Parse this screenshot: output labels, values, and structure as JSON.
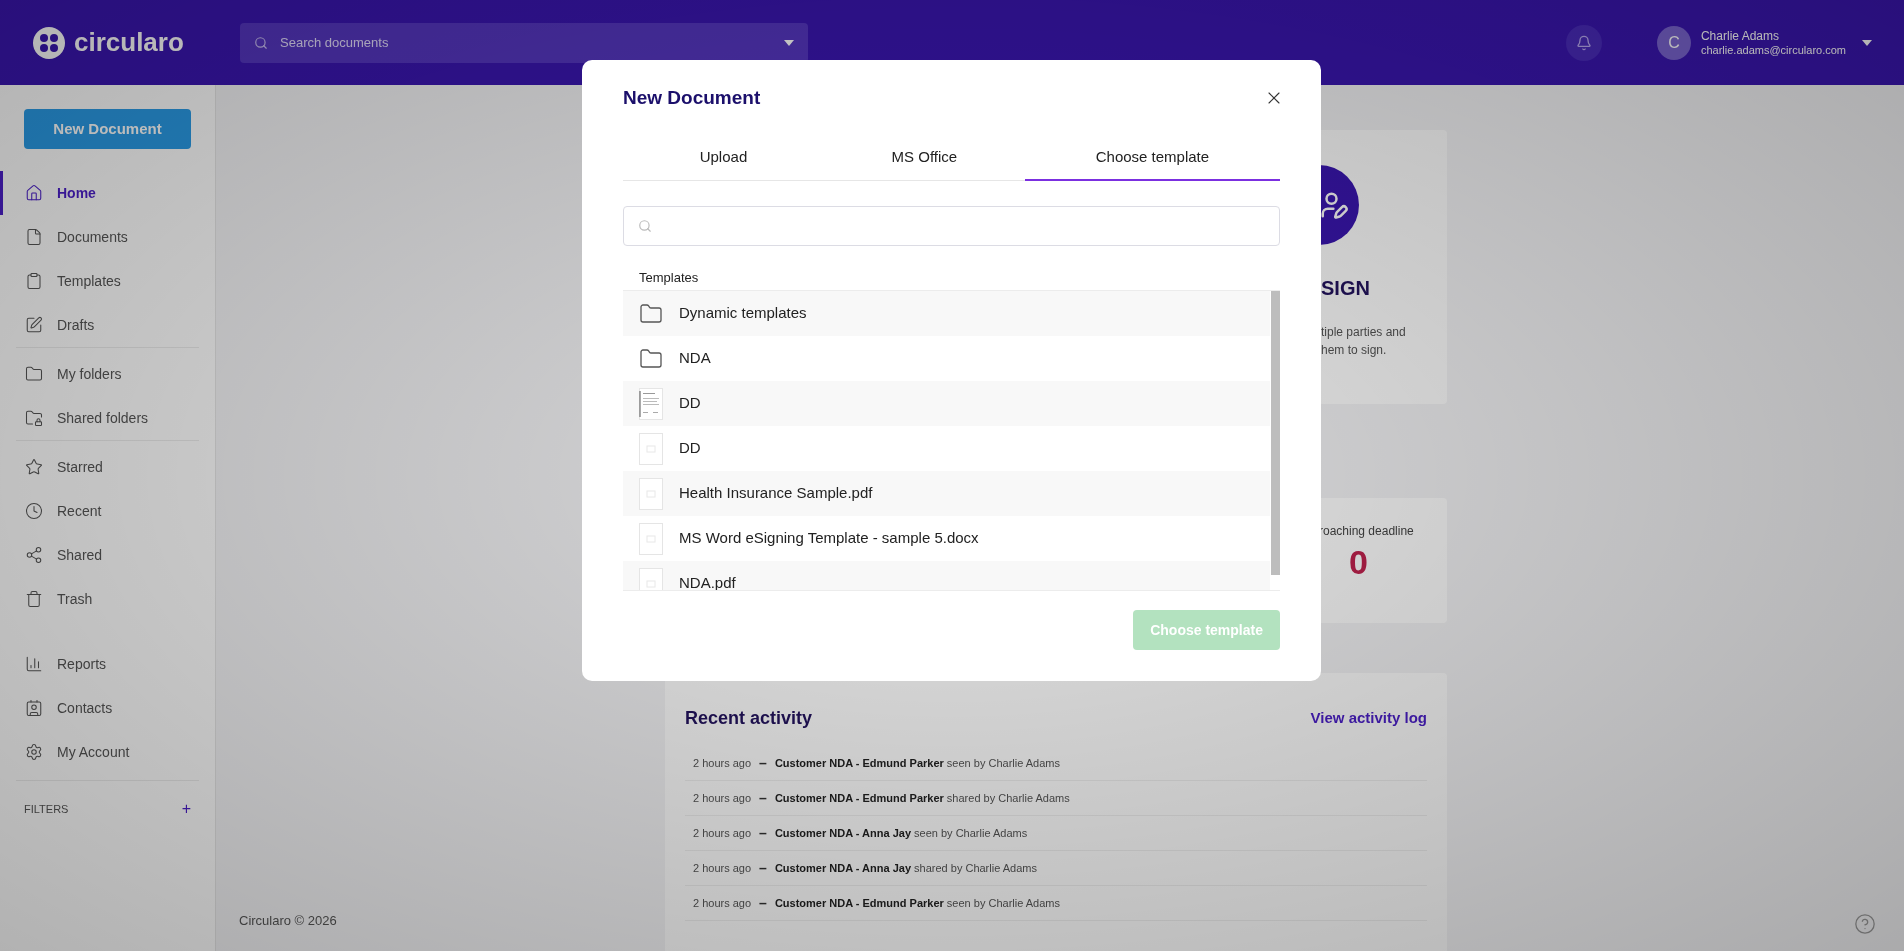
{
  "header": {
    "logo": "circularo",
    "search_placeholder": "Search documents",
    "user": {
      "initial": "C",
      "name": "Charlie Adams",
      "email": "charlie.adams@circularo.com"
    }
  },
  "sidebar": {
    "new_button": "New Document",
    "groups": [
      [
        {
          "label": "Home",
          "selected": true
        },
        {
          "label": "Documents",
          "selected": false
        },
        {
          "label": "Templates",
          "selected": false
        },
        {
          "label": "Drafts",
          "selected": false
        }
      ],
      [
        {
          "label": "My folders",
          "selected": false
        },
        {
          "label": "Shared folders",
          "selected": false
        }
      ],
      [
        {
          "label": "Starred",
          "selected": false
        },
        {
          "label": "Recent",
          "selected": false
        },
        {
          "label": "Shared",
          "selected": false
        },
        {
          "label": "Trash",
          "selected": false
        }
      ],
      [
        {
          "label": "Reports",
          "selected": false
        },
        {
          "label": "Contacts",
          "selected": false
        },
        {
          "label": "My Account",
          "selected": false
        }
      ]
    ],
    "filters_label": "FILTERS",
    "filters_add": "+"
  },
  "sign_card": {
    "title": "SIGN",
    "text": "tiple parties and\nhem to sign."
  },
  "deadline_card": {
    "label": "roaching deadline",
    "value": "0"
  },
  "activity": {
    "title": "Recent activity",
    "link": "View activity log",
    "rows": [
      {
        "time": "2 hours ago",
        "separator": "–",
        "text": "**Customer NDA - Edmund Parker** seen by Charlie Adams"
      },
      {
        "time": "2 hours ago",
        "separator": "–",
        "text": "**Customer NDA - Edmund Parker** shared by Charlie Adams"
      },
      {
        "time": "2 hours ago",
        "separator": "–",
        "text": "**Customer NDA - Anna Jay** seen by Charlie Adams"
      },
      {
        "time": "2 hours ago",
        "separator": "–",
        "text": "**Customer NDA - Anna Jay** shared by Charlie Adams"
      },
      {
        "time": "2 hours ago",
        "separator": "–",
        "text": "**Customer NDA - Edmund Parker** seen by Charlie Adams"
      }
    ]
  },
  "footer": "Circularo © 2026",
  "modal": {
    "title": "New Document",
    "tabs": [
      {
        "label": "Upload",
        "selected": false
      },
      {
        "label": "MS Office",
        "selected": false
      },
      {
        "label": "Choose template",
        "selected": true
      }
    ],
    "list_header": "Templates",
    "items": [
      {
        "kind": "folder",
        "name": "Dynamic templates"
      },
      {
        "kind": "folder",
        "name": "NDA"
      },
      {
        "kind": "preview",
        "name": "DD"
      },
      {
        "kind": "file",
        "name": "DD"
      },
      {
        "kind": "file",
        "name": "Health Insurance Sample.pdf"
      },
      {
        "kind": "file",
        "name": "MS Word eSigning Template - sample 5.docx"
      },
      {
        "kind": "file",
        "name": "NDA.pdf"
      }
    ],
    "button": {
      "label": "Choose template",
      "disabled": true
    }
  }
}
